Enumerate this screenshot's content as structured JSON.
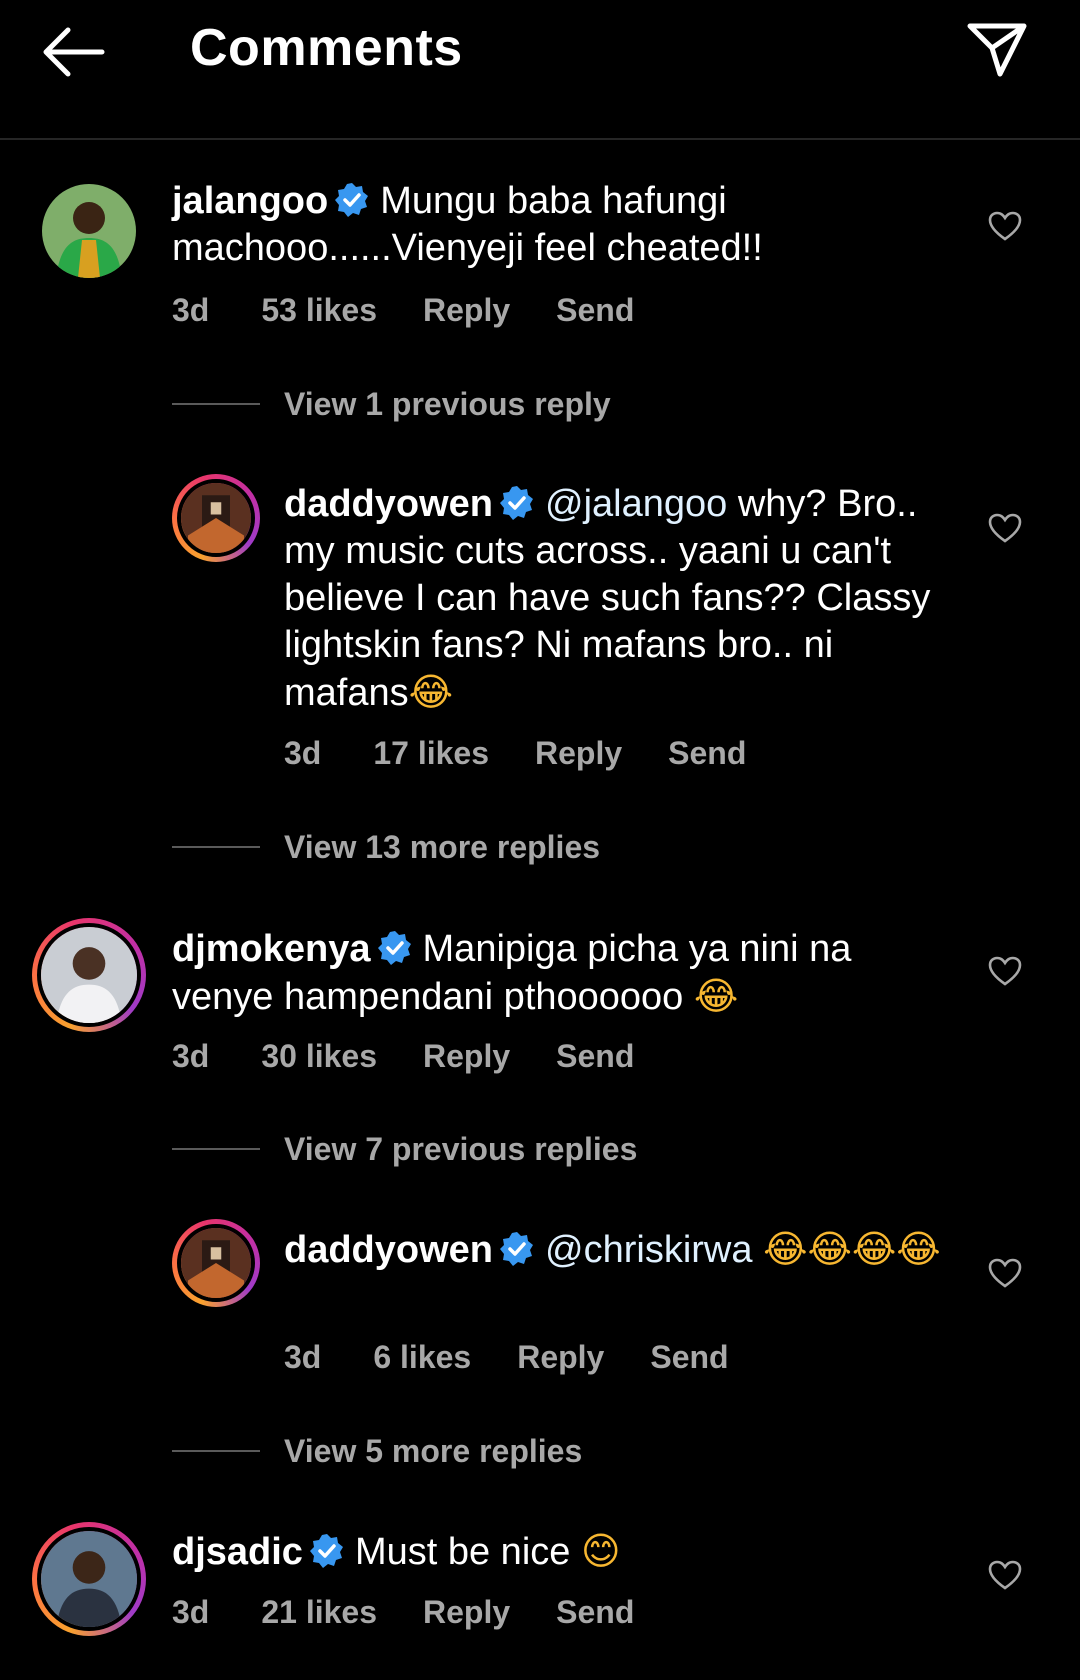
{
  "header": {
    "title": "Comments"
  },
  "comments": [
    {
      "username": "jalangoo",
      "text": "Mungu baba hafungi machooo......Vienyeji feel cheated!!",
      "time": "3d",
      "likes": "53 likes",
      "reply": "Reply",
      "send": "Send"
    },
    {
      "view_link": "View 1 previous reply"
    },
    {
      "username": "daddyowen",
      "mention": "@jalangoo",
      "text": " why? Bro.. my music cuts across.. yaani u can't believe I can have such fans?? Classy lightskin fans? Ni mafans bro.. ni mafans",
      "emoji": "😂",
      "time": "3d",
      "likes": "17 likes",
      "reply": "Reply",
      "send": "Send"
    },
    {
      "view_link": "View 13 more replies"
    },
    {
      "username": "djmokenya",
      "text": "Manipiga picha ya nini na venye hampendani pthoooooo ",
      "emoji": "😂",
      "time": "3d",
      "likes": "30 likes",
      "reply": "Reply",
      "send": "Send"
    },
    {
      "view_link": "View 7 previous replies"
    },
    {
      "username": "daddyowen",
      "mention": "@chriskirwa",
      "text": " ",
      "emoji": "😂😂😂😂",
      "time": "3d",
      "likes": "6 likes",
      "reply": "Reply",
      "send": "Send"
    },
    {
      "view_link": "View 5 more replies"
    },
    {
      "username": "djsadic",
      "text": "Must be nice ",
      "emoji": "😊",
      "time": "3d",
      "likes": "21 likes",
      "reply": "Reply",
      "send": "Send"
    }
  ],
  "colors": {
    "background": "#000000",
    "text": "#ffffff",
    "muted": "#a8a8a8",
    "verified": "#3897f0"
  }
}
